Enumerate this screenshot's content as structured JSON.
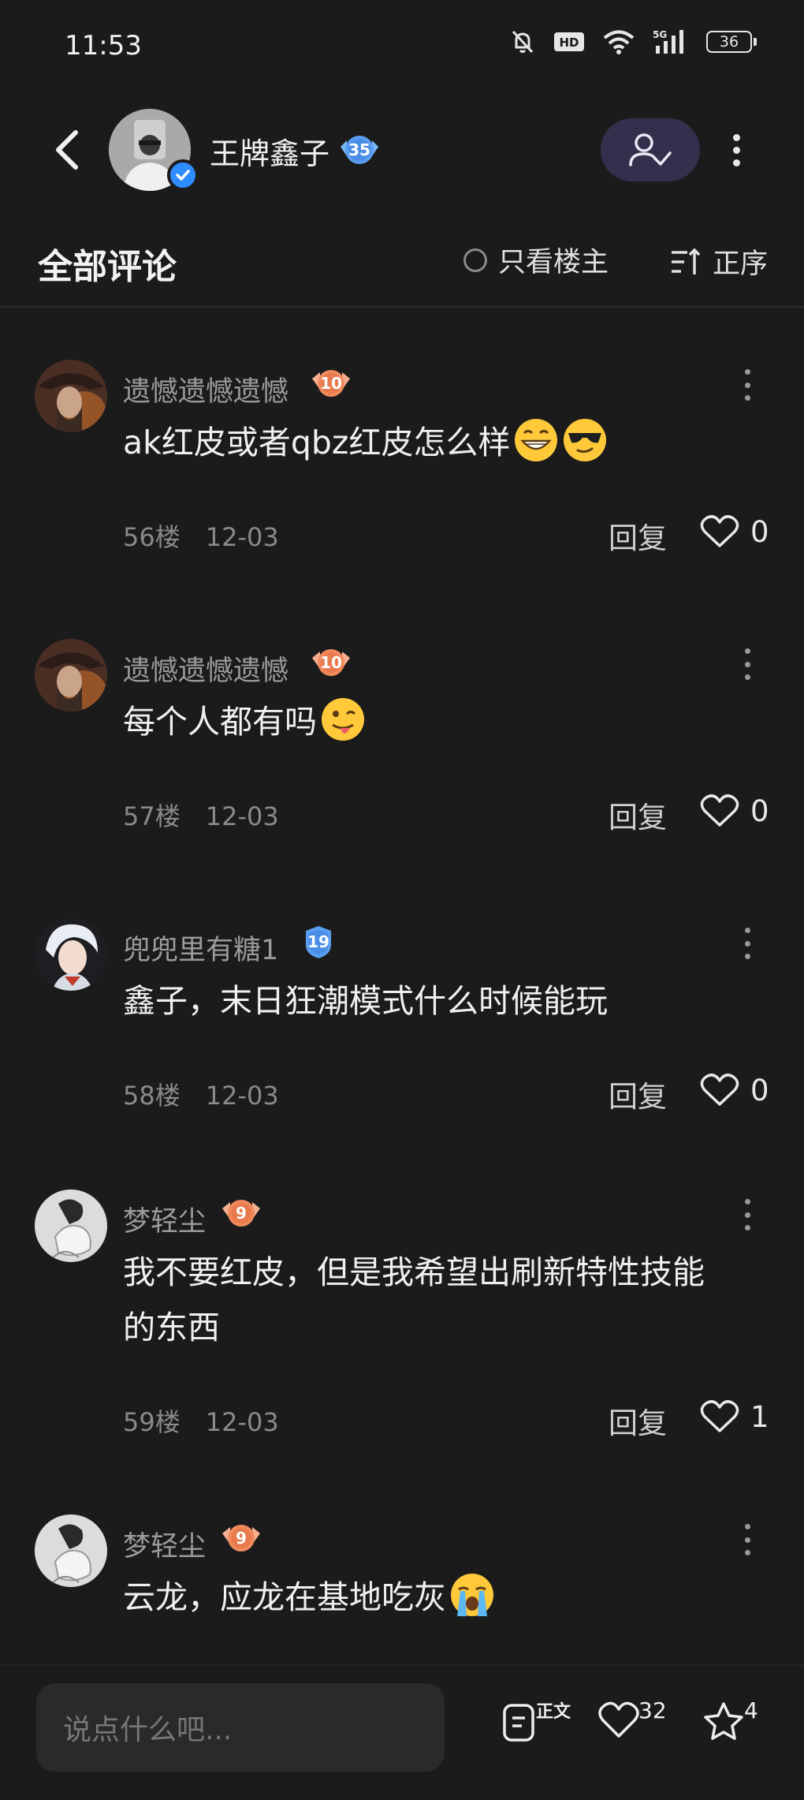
{
  "status_bar": {
    "time": "11:53",
    "battery": "36"
  },
  "header": {
    "author_name": "王牌鑫子",
    "author_level": "35"
  },
  "tabs": {
    "title": "全部评论",
    "op_only_label": "只看楼主",
    "sort_label": "正序"
  },
  "comments": [
    {
      "name": "遗憾遗憾遗憾",
      "level": "10",
      "text": "ak红皮或者qbz红皮怎么样",
      "emojis": [
        "grin",
        "cool"
      ],
      "floor": "56楼",
      "date": "12-03",
      "reply": "回复",
      "likes": "0"
    },
    {
      "name": "遗憾遗憾遗憾",
      "level": "10",
      "text": "每个人都有吗",
      "emojis": [
        "wink-tongue"
      ],
      "floor": "57楼",
      "date": "12-03",
      "reply": "回复",
      "likes": "0"
    },
    {
      "name": "兜兜里有糖1",
      "level": "19",
      "text": "鑫子，末日狂潮模式什么时候能玩",
      "emojis": [],
      "floor": "58楼",
      "date": "12-03",
      "reply": "回复",
      "likes": "0"
    },
    {
      "name": "梦轻尘",
      "level": "9",
      "text_line1": "我不要红皮，但是我希望出刷新特性技能",
      "text_line2": "的东西",
      "emojis": [],
      "floor": "59楼",
      "date": "12-03",
      "reply": "回复",
      "likes": "1"
    },
    {
      "name": "梦轻尘",
      "level": "9",
      "text": "云龙，应龙在基地吃灰",
      "emojis": [
        "crying"
      ]
    }
  ],
  "bottom_bar": {
    "input_placeholder": "说点什么吧...",
    "post_label": "正文",
    "like_count": "32",
    "favorite_count": "4"
  },
  "colors": {
    "background": "#1b1b1c",
    "accent_follow": "#33304d",
    "verified_blue": "#2f8cff",
    "level_orange": "#f08a5d",
    "level_blue": "#5b9df0"
  }
}
